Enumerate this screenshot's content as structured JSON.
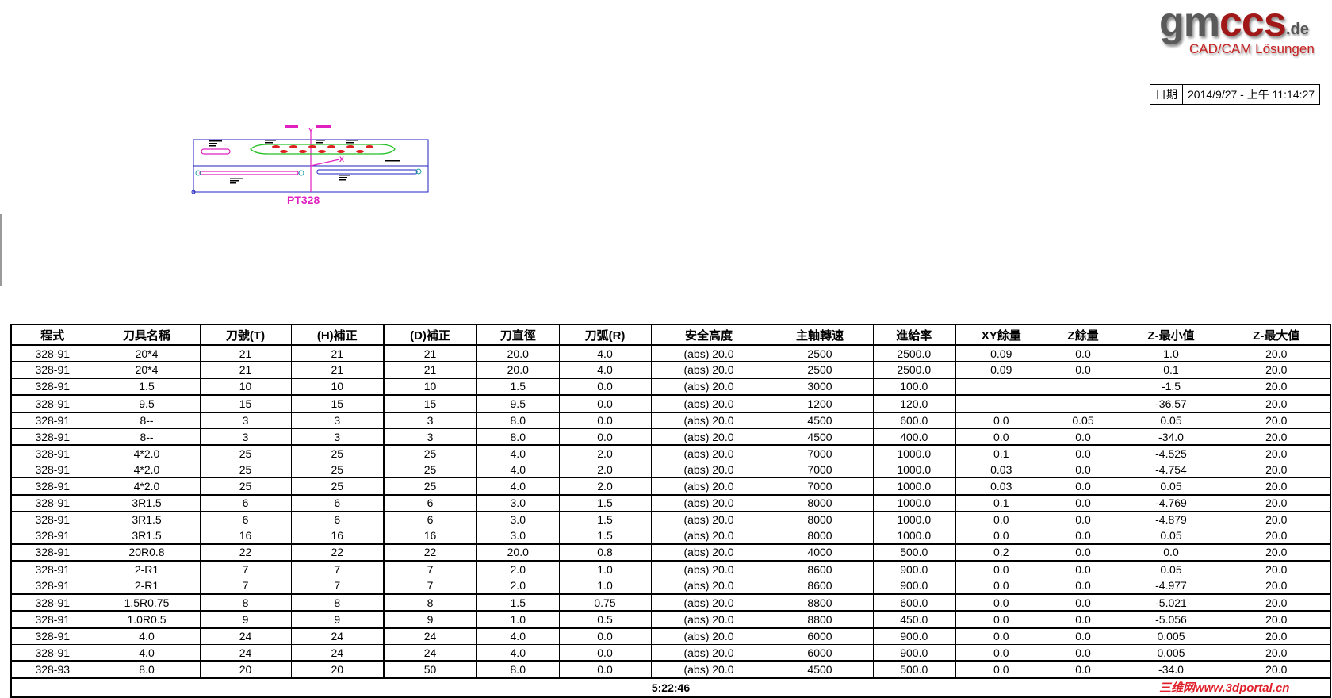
{
  "logo": {
    "brand_a": "gm",
    "brand_b": "ccs",
    "tld": ".de",
    "tagline": "CAD/CAM Lösungen"
  },
  "date": {
    "label": "日期",
    "value": "2014/9/27 - 上午 11:14:27"
  },
  "drawing": {
    "part_label": "PT328",
    "axis_x": "X",
    "axis_y": "Y"
  },
  "table": {
    "headers": [
      "程式",
      "刀具名稱",
      "刀號(T)",
      "(H)補正",
      "(D)補正",
      "刀直徑",
      "刀弧(R)",
      "安全高度",
      "主軸轉速",
      "進給率",
      "XY餘量",
      "Z餘量",
      "Z-最小值",
      "Z-最大值"
    ],
    "rows": [
      [
        "328-91",
        "20*4",
        "21",
        "21",
        "21",
        "20.0",
        "4.0",
        "(abs) 20.0",
        "2500",
        "2500.0",
        "0.09",
        "0.0",
        "1.0",
        "20.0"
      ],
      [
        "328-91",
        "20*4",
        "21",
        "21",
        "21",
        "20.0",
        "4.0",
        "(abs) 20.0",
        "2500",
        "2500.0",
        "0.09",
        "0.0",
        "0.1",
        "20.0"
      ],
      [
        "328-91",
        "1.5",
        "10",
        "10",
        "10",
        "1.5",
        "0.0",
        "(abs) 20.0",
        "3000",
        "100.0",
        "",
        "",
        "-1.5",
        "20.0"
      ],
      [
        "328-91",
        "9.5",
        "15",
        "15",
        "15",
        "9.5",
        "0.0",
        "(abs) 20.0",
        "1200",
        "120.0",
        "",
        "",
        "-36.57",
        "20.0"
      ],
      [
        "328-91",
        "8--",
        "3",
        "3",
        "3",
        "8.0",
        "0.0",
        "(abs) 20.0",
        "4500",
        "600.0",
        "0.0",
        "0.05",
        "0.05",
        "20.0"
      ],
      [
        "328-91",
        "8--",
        "3",
        "3",
        "3",
        "8.0",
        "0.0",
        "(abs) 20.0",
        "4500",
        "400.0",
        "0.0",
        "0.0",
        "-34.0",
        "20.0"
      ],
      [
        "328-91",
        "4*2.0",
        "25",
        "25",
        "25",
        "4.0",
        "2.0",
        "(abs) 20.0",
        "7000",
        "1000.0",
        "0.1",
        "0.0",
        "-4.525",
        "20.0"
      ],
      [
        "328-91",
        "4*2.0",
        "25",
        "25",
        "25",
        "4.0",
        "2.0",
        "(abs) 20.0",
        "7000",
        "1000.0",
        "0.03",
        "0.0",
        "-4.754",
        "20.0"
      ],
      [
        "328-91",
        "4*2.0",
        "25",
        "25",
        "25",
        "4.0",
        "2.0",
        "(abs) 20.0",
        "7000",
        "1000.0",
        "0.03",
        "0.0",
        "0.05",
        "20.0"
      ],
      [
        "328-91",
        "3R1.5",
        "6",
        "6",
        "6",
        "3.0",
        "1.5",
        "(abs) 20.0",
        "8000",
        "1000.0",
        "0.1",
        "0.0",
        "-4.769",
        "20.0"
      ],
      [
        "328-91",
        "3R1.5",
        "6",
        "6",
        "6",
        "3.0",
        "1.5",
        "(abs) 20.0",
        "8000",
        "1000.0",
        "0.0",
        "0.0",
        "-4.879",
        "20.0"
      ],
      [
        "328-91",
        "3R1.5",
        "16",
        "16",
        "16",
        "3.0",
        "1.5",
        "(abs) 20.0",
        "8000",
        "1000.0",
        "0.0",
        "0.0",
        "0.05",
        "20.0"
      ],
      [
        "328-91",
        "20R0.8",
        "22",
        "22",
        "22",
        "20.0",
        "0.8",
        "(abs) 20.0",
        "4000",
        "500.0",
        "0.2",
        "0.0",
        "0.0",
        "20.0"
      ],
      [
        "328-91",
        "2-R1",
        "7",
        "7",
        "7",
        "2.0",
        "1.0",
        "(abs) 20.0",
        "8600",
        "900.0",
        "0.0",
        "0.0",
        "0.05",
        "20.0"
      ],
      [
        "328-91",
        "2-R1",
        "7",
        "7",
        "7",
        "2.0",
        "1.0",
        "(abs) 20.0",
        "8600",
        "900.0",
        "0.0",
        "0.0",
        "-4.977",
        "20.0"
      ],
      [
        "328-91",
        "1.5R0.75",
        "8",
        "8",
        "8",
        "1.5",
        "0.75",
        "(abs) 20.0",
        "8800",
        "600.0",
        "0.0",
        "0.0",
        "-5.021",
        "20.0"
      ],
      [
        "328-91",
        "1.0R0.5",
        "9",
        "9",
        "9",
        "1.0",
        "0.5",
        "(abs) 20.0",
        "8800",
        "450.0",
        "0.0",
        "0.0",
        "-5.056",
        "20.0"
      ],
      [
        "328-91",
        "4.0",
        "24",
        "24",
        "24",
        "4.0",
        "0.0",
        "(abs) 20.0",
        "6000",
        "900.0",
        "0.0",
        "0.0",
        "0.005",
        "20.0"
      ],
      [
        "328-91",
        "4.0",
        "24",
        "24",
        "24",
        "4.0",
        "0.0",
        "(abs) 20.0",
        "6000",
        "900.0",
        "0.0",
        "0.0",
        "0.005",
        "20.0"
      ],
      [
        "328-93",
        "8.0",
        "20",
        "20",
        "50",
        "8.0",
        "0.0",
        "(abs) 20.0",
        "4500",
        "500.0",
        "0.0",
        "0.0",
        "-34.0",
        "20.0"
      ]
    ],
    "group_start_rows": [
      0,
      2,
      3,
      4,
      6,
      9,
      12,
      13,
      15,
      16,
      17,
      19
    ],
    "total_time": "5:22:46"
  },
  "watermark": "三维网www.3dportal.cn",
  "colors": {
    "logo_gray": "#5a5a5a",
    "logo_red": "#a01818",
    "tagline_red": "#c82020",
    "drawing_blue": "#2020c0",
    "drawing_magenta": "#e020c0",
    "drawing_green": "#20c020",
    "drawing_red": "#e02020"
  }
}
